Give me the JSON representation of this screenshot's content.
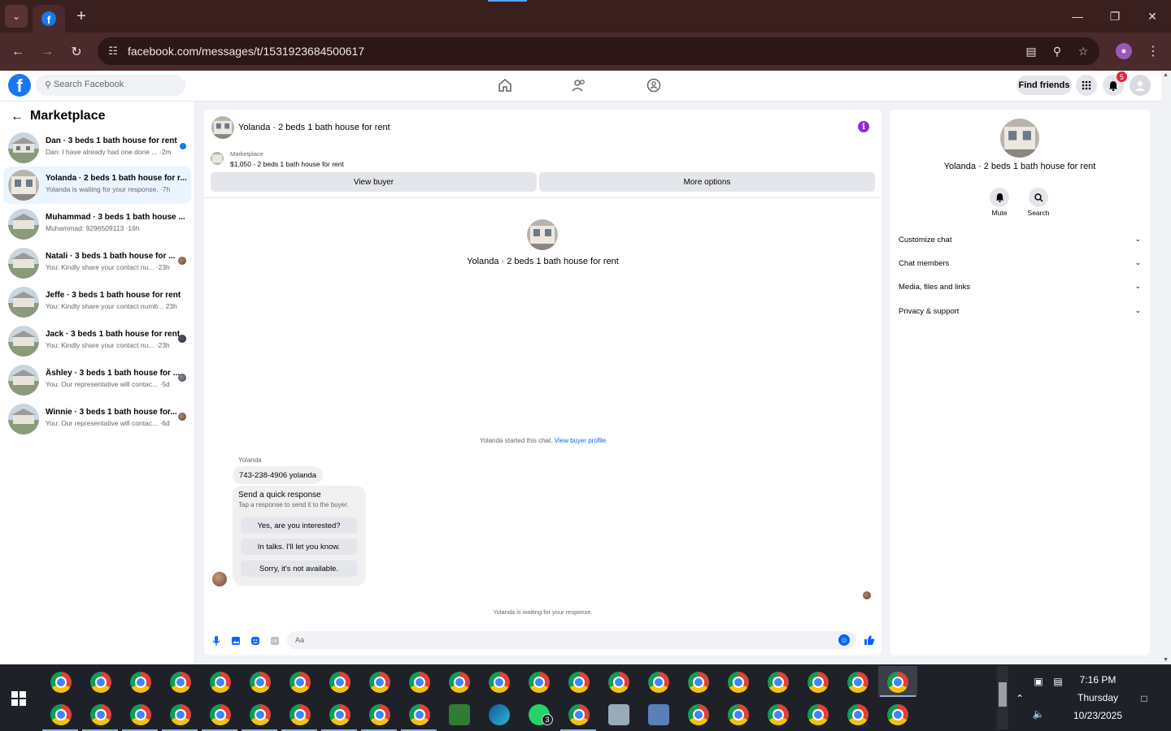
{
  "browser": {
    "url": "facebook.com/messages/t/1531923684500617"
  },
  "header": {
    "search_placeholder": "Search Facebook",
    "find_friends": "Find friends",
    "notification_count": "5"
  },
  "sidebar": {
    "title": "Marketplace",
    "conversations": [
      {
        "name": "Dan · 3 beds 1 bath house for rent",
        "snippet": "Dan: I have already had one done ... ·2m"
      },
      {
        "name": "Yolanda · 2 beds 1 bath house for r...",
        "snippet": "Yolanda is waiting for your response. ·7h"
      },
      {
        "name": "Muhammad · 3 beds 1 bath house ...",
        "snippet": "Muhammad: 9296509113 ·16h"
      },
      {
        "name": "Natali · 3 beds 1 bath house for ...",
        "snippet": "You: Kindly share your contact nu... ·23h"
      },
      {
        "name": "Jeffe · 3 beds 1 bath house for rent",
        "snippet": "You: Kindly share your contact numb... 23h"
      },
      {
        "name": "Jack · 3 beds 1 bath house for rent",
        "snippet": "You: Kindly share your contact nu... ·23h"
      },
      {
        "name": "Äshley · 3 beds 1 bath house for ...",
        "snippet": "You: Our representative will contac... ·5d"
      },
      {
        "name": "Winnie · 3 beds 1 bath house for...",
        "snippet": "You: Our representative will contac... ·6d"
      }
    ]
  },
  "chat": {
    "title": "Yolanda · 2 beds 1 bath house for rent",
    "listing_source": "Marketplace",
    "listing_desc": "$1,050 - 2 beds 1 bath house for rent",
    "view_buyer": "View buyer",
    "more_options": "More options",
    "center_title": "Yolanda · 2 beds 1 bath house for rent",
    "started_text": "Yolanda started this chat.",
    "view_buyer_profile": "View buyer profile",
    "sender": "Yolanda",
    "message": "743-238-4906 yolanda",
    "quick_title": "Send a quick response",
    "quick_sub": "Tap a response to send it to the buyer.",
    "quick_responses": [
      "Yes, are you interested?",
      "In talks. I'll let you know.",
      "Sorry, it's not available."
    ],
    "waiting": "Yolanda is waiting for your response.",
    "composer_placeholder": "Aa"
  },
  "right_panel": {
    "title": "Yolanda · 2 beds 1 bath house for rent",
    "mute": "Mute",
    "search": "Search",
    "sections": [
      "Customize chat",
      "Chat members",
      "Media, files and links",
      "Privacy & support"
    ]
  },
  "taskbar": {
    "time": "7:16 PM",
    "day": "Thursday",
    "date": "10/23/2025",
    "whatsapp_badge": "3"
  }
}
